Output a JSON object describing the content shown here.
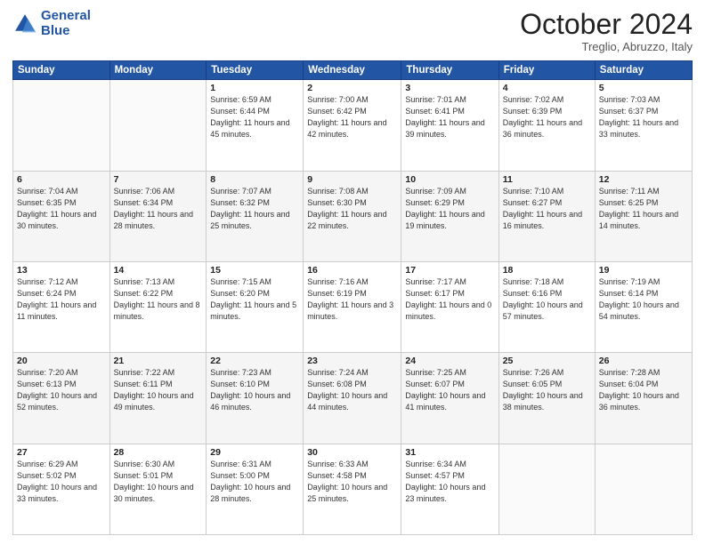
{
  "logo": {
    "line1": "General",
    "line2": "Blue"
  },
  "title": "October 2024",
  "location": "Treglio, Abruzzo, Italy",
  "days_of_week": [
    "Sunday",
    "Monday",
    "Tuesday",
    "Wednesday",
    "Thursday",
    "Friday",
    "Saturday"
  ],
  "weeks": [
    [
      {
        "day": "",
        "info": ""
      },
      {
        "day": "",
        "info": ""
      },
      {
        "day": "1",
        "info": "Sunrise: 6:59 AM\nSunset: 6:44 PM\nDaylight: 11 hours\nand 45 minutes."
      },
      {
        "day": "2",
        "info": "Sunrise: 7:00 AM\nSunset: 6:42 PM\nDaylight: 11 hours\nand 42 minutes."
      },
      {
        "day": "3",
        "info": "Sunrise: 7:01 AM\nSunset: 6:41 PM\nDaylight: 11 hours\nand 39 minutes."
      },
      {
        "day": "4",
        "info": "Sunrise: 7:02 AM\nSunset: 6:39 PM\nDaylight: 11 hours\nand 36 minutes."
      },
      {
        "day": "5",
        "info": "Sunrise: 7:03 AM\nSunset: 6:37 PM\nDaylight: 11 hours\nand 33 minutes."
      }
    ],
    [
      {
        "day": "6",
        "info": "Sunrise: 7:04 AM\nSunset: 6:35 PM\nDaylight: 11 hours\nand 30 minutes."
      },
      {
        "day": "7",
        "info": "Sunrise: 7:06 AM\nSunset: 6:34 PM\nDaylight: 11 hours\nand 28 minutes."
      },
      {
        "day": "8",
        "info": "Sunrise: 7:07 AM\nSunset: 6:32 PM\nDaylight: 11 hours\nand 25 minutes."
      },
      {
        "day": "9",
        "info": "Sunrise: 7:08 AM\nSunset: 6:30 PM\nDaylight: 11 hours\nand 22 minutes."
      },
      {
        "day": "10",
        "info": "Sunrise: 7:09 AM\nSunset: 6:29 PM\nDaylight: 11 hours\nand 19 minutes."
      },
      {
        "day": "11",
        "info": "Sunrise: 7:10 AM\nSunset: 6:27 PM\nDaylight: 11 hours\nand 16 minutes."
      },
      {
        "day": "12",
        "info": "Sunrise: 7:11 AM\nSunset: 6:25 PM\nDaylight: 11 hours\nand 14 minutes."
      }
    ],
    [
      {
        "day": "13",
        "info": "Sunrise: 7:12 AM\nSunset: 6:24 PM\nDaylight: 11 hours\nand 11 minutes."
      },
      {
        "day": "14",
        "info": "Sunrise: 7:13 AM\nSunset: 6:22 PM\nDaylight: 11 hours\nand 8 minutes."
      },
      {
        "day": "15",
        "info": "Sunrise: 7:15 AM\nSunset: 6:20 PM\nDaylight: 11 hours\nand 5 minutes."
      },
      {
        "day": "16",
        "info": "Sunrise: 7:16 AM\nSunset: 6:19 PM\nDaylight: 11 hours\nand 3 minutes."
      },
      {
        "day": "17",
        "info": "Sunrise: 7:17 AM\nSunset: 6:17 PM\nDaylight: 11 hours\nand 0 minutes."
      },
      {
        "day": "18",
        "info": "Sunrise: 7:18 AM\nSunset: 6:16 PM\nDaylight: 10 hours\nand 57 minutes."
      },
      {
        "day": "19",
        "info": "Sunrise: 7:19 AM\nSunset: 6:14 PM\nDaylight: 10 hours\nand 54 minutes."
      }
    ],
    [
      {
        "day": "20",
        "info": "Sunrise: 7:20 AM\nSunset: 6:13 PM\nDaylight: 10 hours\nand 52 minutes."
      },
      {
        "day": "21",
        "info": "Sunrise: 7:22 AM\nSunset: 6:11 PM\nDaylight: 10 hours\nand 49 minutes."
      },
      {
        "day": "22",
        "info": "Sunrise: 7:23 AM\nSunset: 6:10 PM\nDaylight: 10 hours\nand 46 minutes."
      },
      {
        "day": "23",
        "info": "Sunrise: 7:24 AM\nSunset: 6:08 PM\nDaylight: 10 hours\nand 44 minutes."
      },
      {
        "day": "24",
        "info": "Sunrise: 7:25 AM\nSunset: 6:07 PM\nDaylight: 10 hours\nand 41 minutes."
      },
      {
        "day": "25",
        "info": "Sunrise: 7:26 AM\nSunset: 6:05 PM\nDaylight: 10 hours\nand 38 minutes."
      },
      {
        "day": "26",
        "info": "Sunrise: 7:28 AM\nSunset: 6:04 PM\nDaylight: 10 hours\nand 36 minutes."
      }
    ],
    [
      {
        "day": "27",
        "info": "Sunrise: 6:29 AM\nSunset: 5:02 PM\nDaylight: 10 hours\nand 33 minutes."
      },
      {
        "day": "28",
        "info": "Sunrise: 6:30 AM\nSunset: 5:01 PM\nDaylight: 10 hours\nand 30 minutes."
      },
      {
        "day": "29",
        "info": "Sunrise: 6:31 AM\nSunset: 5:00 PM\nDaylight: 10 hours\nand 28 minutes."
      },
      {
        "day": "30",
        "info": "Sunrise: 6:33 AM\nSunset: 4:58 PM\nDaylight: 10 hours\nand 25 minutes."
      },
      {
        "day": "31",
        "info": "Sunrise: 6:34 AM\nSunset: 4:57 PM\nDaylight: 10 hours\nand 23 minutes."
      },
      {
        "day": "",
        "info": ""
      },
      {
        "day": "",
        "info": ""
      }
    ]
  ]
}
